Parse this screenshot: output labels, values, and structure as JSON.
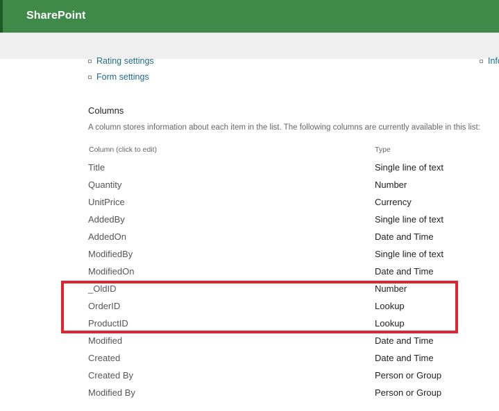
{
  "app": {
    "brand": "SharePoint"
  },
  "settings_links": [
    {
      "label": "Rating settings"
    },
    {
      "label": "Form settings"
    }
  ],
  "right_link": {
    "label": "Info"
  },
  "columns_section": {
    "title": "Columns",
    "description": "A column stores information about each item in the list. The following columns are currently available in this list:",
    "header_column": "Column (click to edit)",
    "header_type": "Type",
    "rows": [
      {
        "name": "Title",
        "type": "Single line of text"
      },
      {
        "name": "Quantity",
        "type": "Number"
      },
      {
        "name": "UnitPrice",
        "type": "Currency"
      },
      {
        "name": "AddedBy",
        "type": "Single line of text"
      },
      {
        "name": "AddedOn",
        "type": "Date and Time"
      },
      {
        "name": "ModifiedBy",
        "type": "Single line of text"
      },
      {
        "name": "ModifiedOn",
        "type": "Date and Time"
      },
      {
        "name": "_OldID",
        "type": "Number"
      },
      {
        "name": "OrderID",
        "type": "Lookup"
      },
      {
        "name": "ProductID",
        "type": "Lookup"
      },
      {
        "name": "Modified",
        "type": "Date and Time"
      },
      {
        "name": "Created",
        "type": "Date and Time"
      },
      {
        "name": "Created By",
        "type": "Person or Group"
      },
      {
        "name": "Modified By",
        "type": "Person or Group"
      }
    ]
  },
  "annotation": {
    "color": "#e2232f"
  }
}
